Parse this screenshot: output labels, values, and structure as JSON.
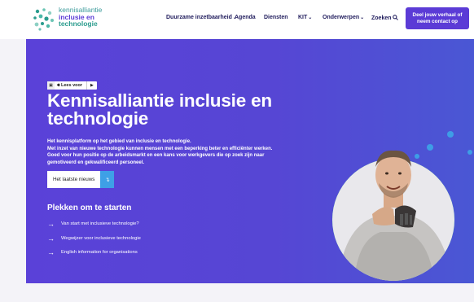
{
  "logo": {
    "line1": "kennisalliantie",
    "line2": "inclusie en",
    "line3": "technologie"
  },
  "nav": {
    "items": [
      {
        "label": "Duurzame inzetbaarheid",
        "chevron": true
      },
      {
        "label": "Agenda",
        "chevron": false
      },
      {
        "label": "Diensten",
        "chevron": false
      },
      {
        "label": "KIT",
        "chevron": true
      },
      {
        "label": "Onderwerpen",
        "chevron": true
      },
      {
        "label": "Zoeken",
        "chevron": false
      }
    ],
    "cta_line1": "Deel jouw verhaal of",
    "cta_line2": "neem contact op"
  },
  "readspeaker": {
    "label": "Lees voor"
  },
  "hero": {
    "title": "Kennisalliantie inclusie en technologie",
    "intro_line1": "Het kennisplatform op het gebied van inclusie en technologie.",
    "intro_line2": "Met inzet van nieuwe technologie kunnen mensen met een beperking beter en efficiënter werken. Goed voor hun positie op de arbeidsmarkt en een kans voor werkgevers die op zoek zijn naar gemotiveerd en gekwalificeerd personeel.",
    "news_button": "Het laatste nieuws",
    "start_title": "Plekken om te starten",
    "start_links": [
      "Van start met inclusieve technologie?",
      "Wegwijzer voor inclusieve technologie",
      "English information for organisations"
    ]
  },
  "colors": {
    "brand": "#5b3bd6",
    "hero_bg": "#5646d4",
    "accent_green": "#21c25e",
    "accent_blue": "#3ea0e6"
  }
}
